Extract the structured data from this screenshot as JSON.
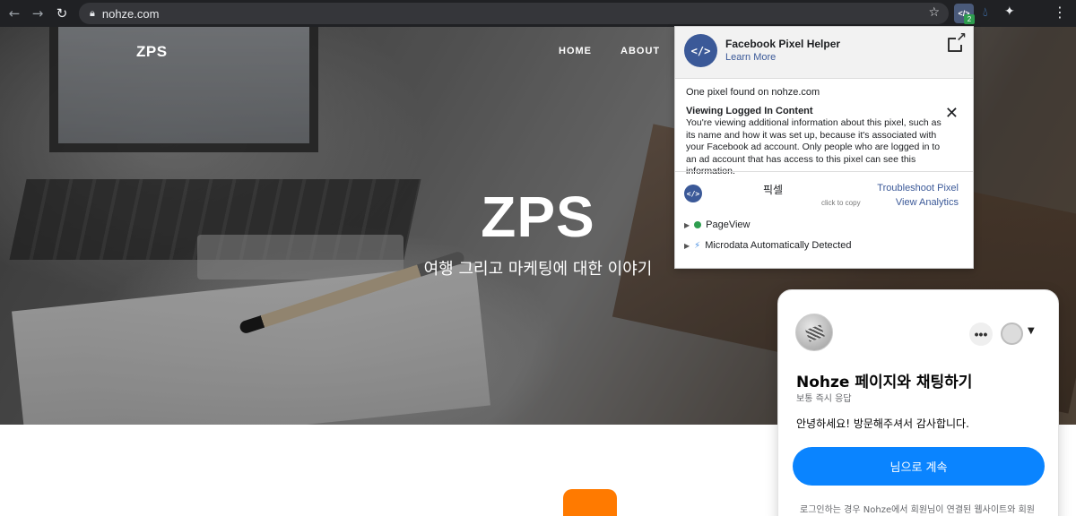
{
  "browser": {
    "url": "nohze.com",
    "extension_badge": "2"
  },
  "site": {
    "logo": "ZPS",
    "nav": [
      "HOME",
      "ABOUT"
    ],
    "hero_title": "ZPS",
    "hero_subtitle": "여행 그리고 마케팅에 대한 이야기"
  },
  "pixel_helper": {
    "title": "Facebook Pixel Helper",
    "learn_more": "Learn More",
    "found_text": "One pixel found on nohze.com",
    "notice_title": "Viewing Logged In Content",
    "notice_body": "You're viewing additional information about this pixel, such as its name and how it was set up, because it's associated with your Facebook ad account. Only people who are logged in to an ad account that has access to this pixel can see this information.",
    "pixel_name": "픽셀",
    "click_to_copy": "click to copy",
    "troubleshoot": "Troubleshoot Pixel",
    "view_analytics": "View Analytics",
    "events": [
      {
        "name": "PageView",
        "status": "ok"
      },
      {
        "name": "Microdata Automatically Detected",
        "status": "info"
      }
    ]
  },
  "chat": {
    "title": "Nohze 페이지와 채팅하기",
    "subtitle": "보통 즉시 응답",
    "greeting": "안녕하세요! 방문해주셔서 감사합니다.",
    "continue_label": "님으로 계속",
    "more_label": "•••",
    "disclaimer": "로그인하는 경우 Nohze에서 회원님이 연결된 웹사이트와 회원"
  }
}
